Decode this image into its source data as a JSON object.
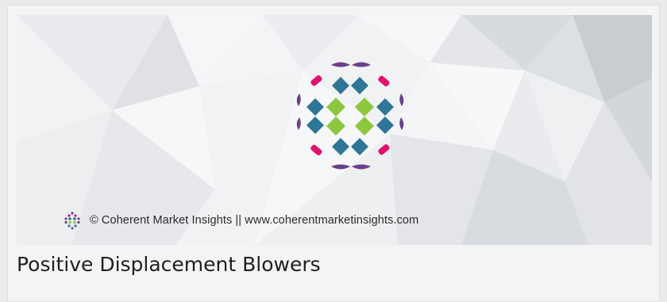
{
  "banner": {
    "logo_name": "coherent-market-insights-logo",
    "credit": "© Coherent Market Insights || www.coherentmarketinsights.com",
    "brand_colors": {
      "purple": "#6b3f8c",
      "magenta": "#e0126d",
      "blue": "#2f7596",
      "green": "#8dc63f"
    }
  },
  "product": {
    "title": "Positive Displacement Blowers"
  }
}
